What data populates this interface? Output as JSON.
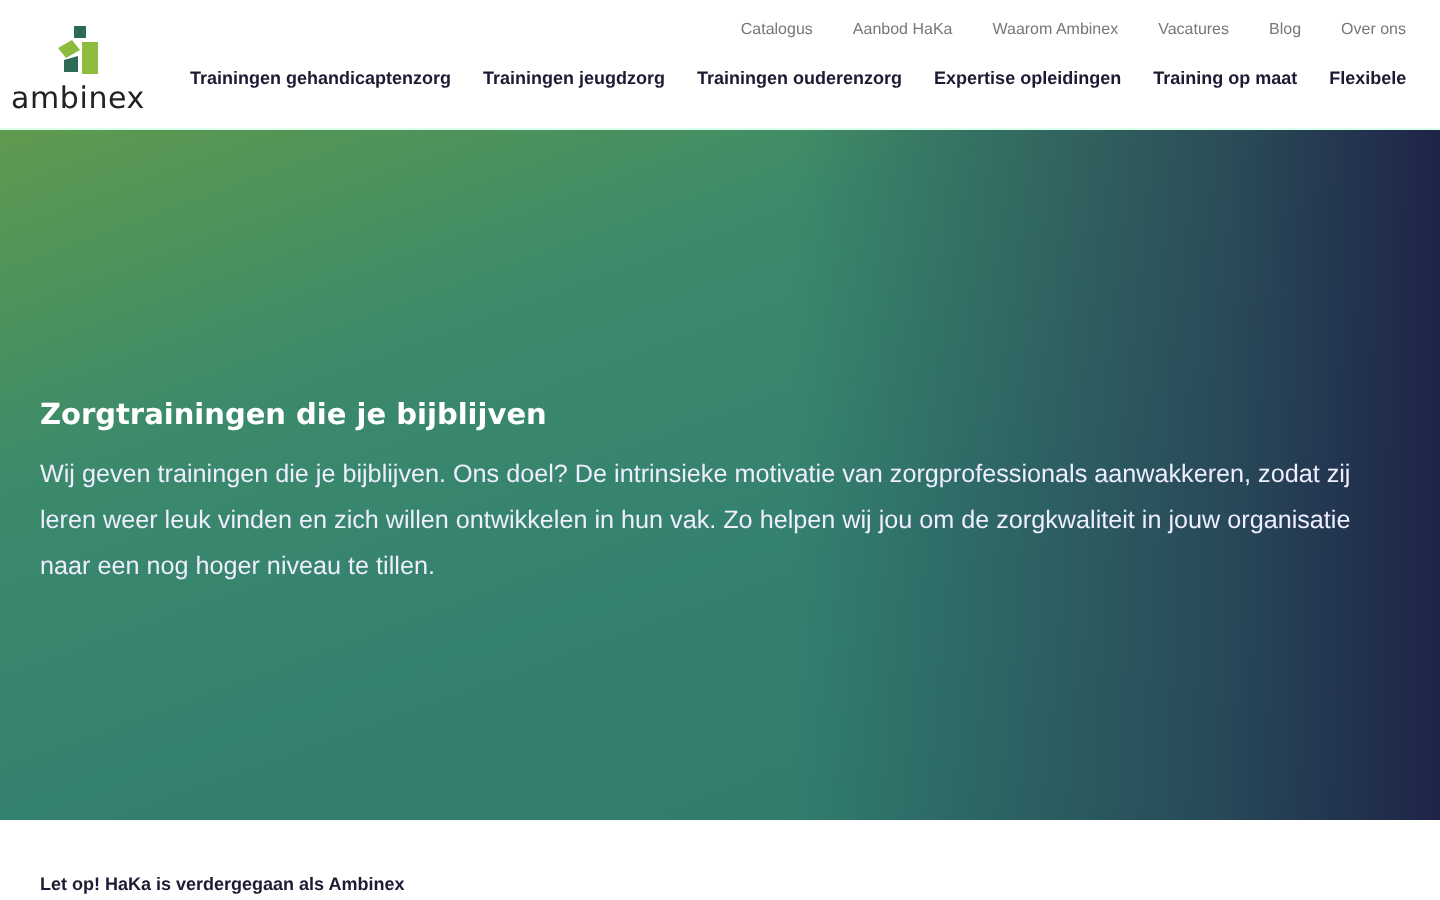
{
  "logo": {
    "text": "ambinex"
  },
  "top_links": [
    "Catalogus",
    "Aanbod HaKa",
    "Waarom Ambinex",
    "Vacatures",
    "Blog",
    "Over ons"
  ],
  "main_nav": [
    "Trainingen gehandicaptenzorg",
    "Trainingen jeugdzorg",
    "Trainingen ouderenzorg",
    "Expertise opleidingen",
    "Training op maat",
    "Flexibele"
  ],
  "hero": {
    "title": "Zorgtrainingen die je bijblijven",
    "text": "Wij geven trainingen die je bijblijven. Ons doel? De intrinsieke motivatie van zorgprofessionals aanwakkeren, zodat zij leren weer leuk vinden en zich willen ontwikkelen in hun vak. Zo helpen wij jou om de zorgkwaliteit in jouw organisatie naar een nog hoger niveau te tillen."
  },
  "notice": {
    "title": "Let op! HaKa is verdergegaan als Ambinex"
  }
}
